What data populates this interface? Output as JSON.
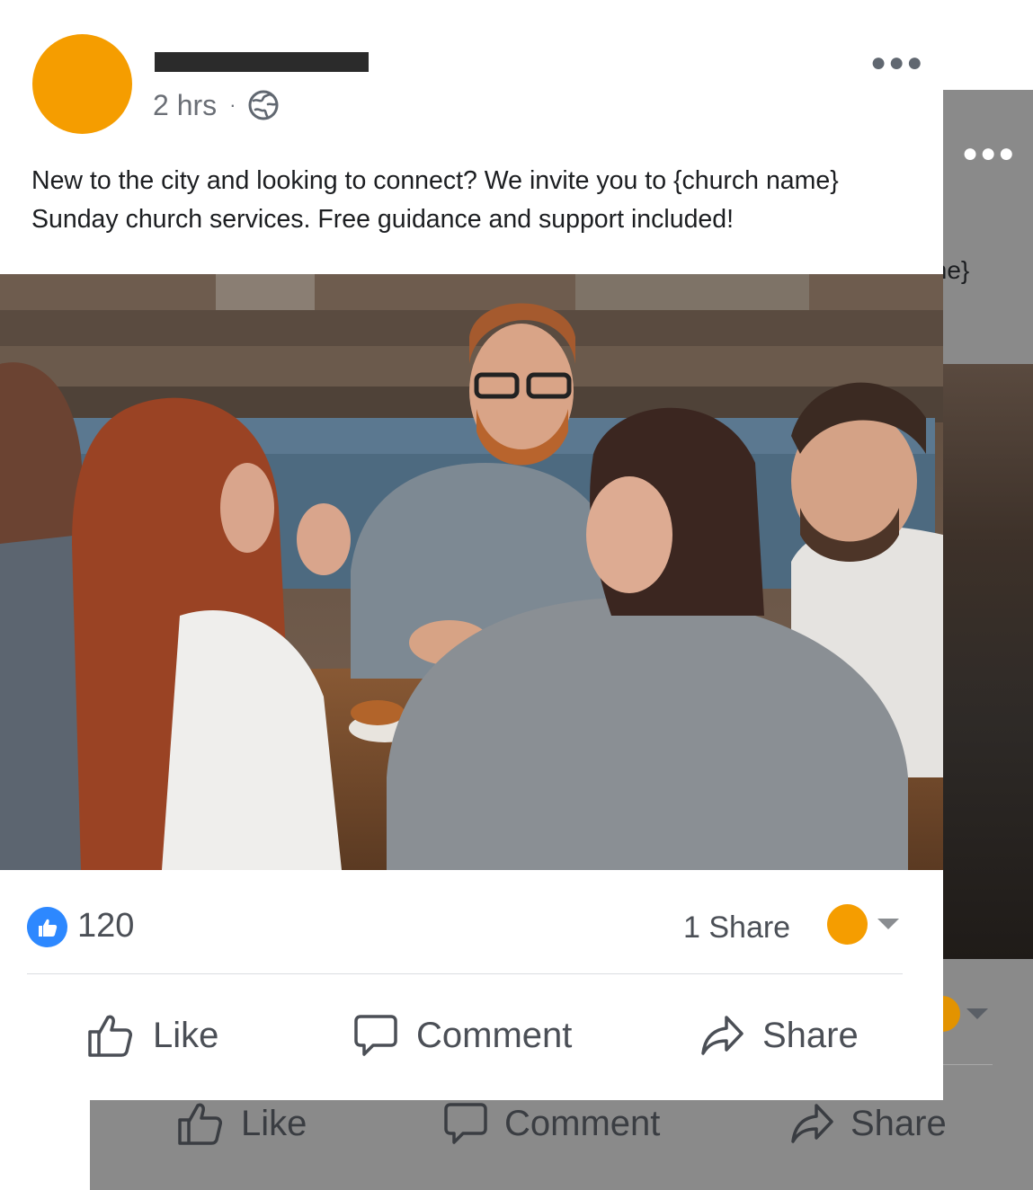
{
  "post": {
    "time": "2 hrs",
    "separator": "·",
    "privacy_icon": "globe-icon",
    "more_icon": "more-dots-icon",
    "text": "New to the city and looking to connect? We invite you to {church name} Sunday church services. Free guidance and support included!",
    "image_icon": "group-photo",
    "avatar_color": "#f59d00"
  },
  "stats": {
    "like_count": "120",
    "share_count": "1 Share"
  },
  "actions": {
    "like": "Like",
    "comment": "Comment",
    "share": "Share"
  },
  "back_card": {
    "text_tail": "me}",
    "like": "Like",
    "comment": "Comment",
    "share": "Share"
  },
  "colors": {
    "accent_blue": "#2d88ff",
    "avatar_orange": "#f59d00",
    "shadow_card": "#8a8a8a"
  }
}
